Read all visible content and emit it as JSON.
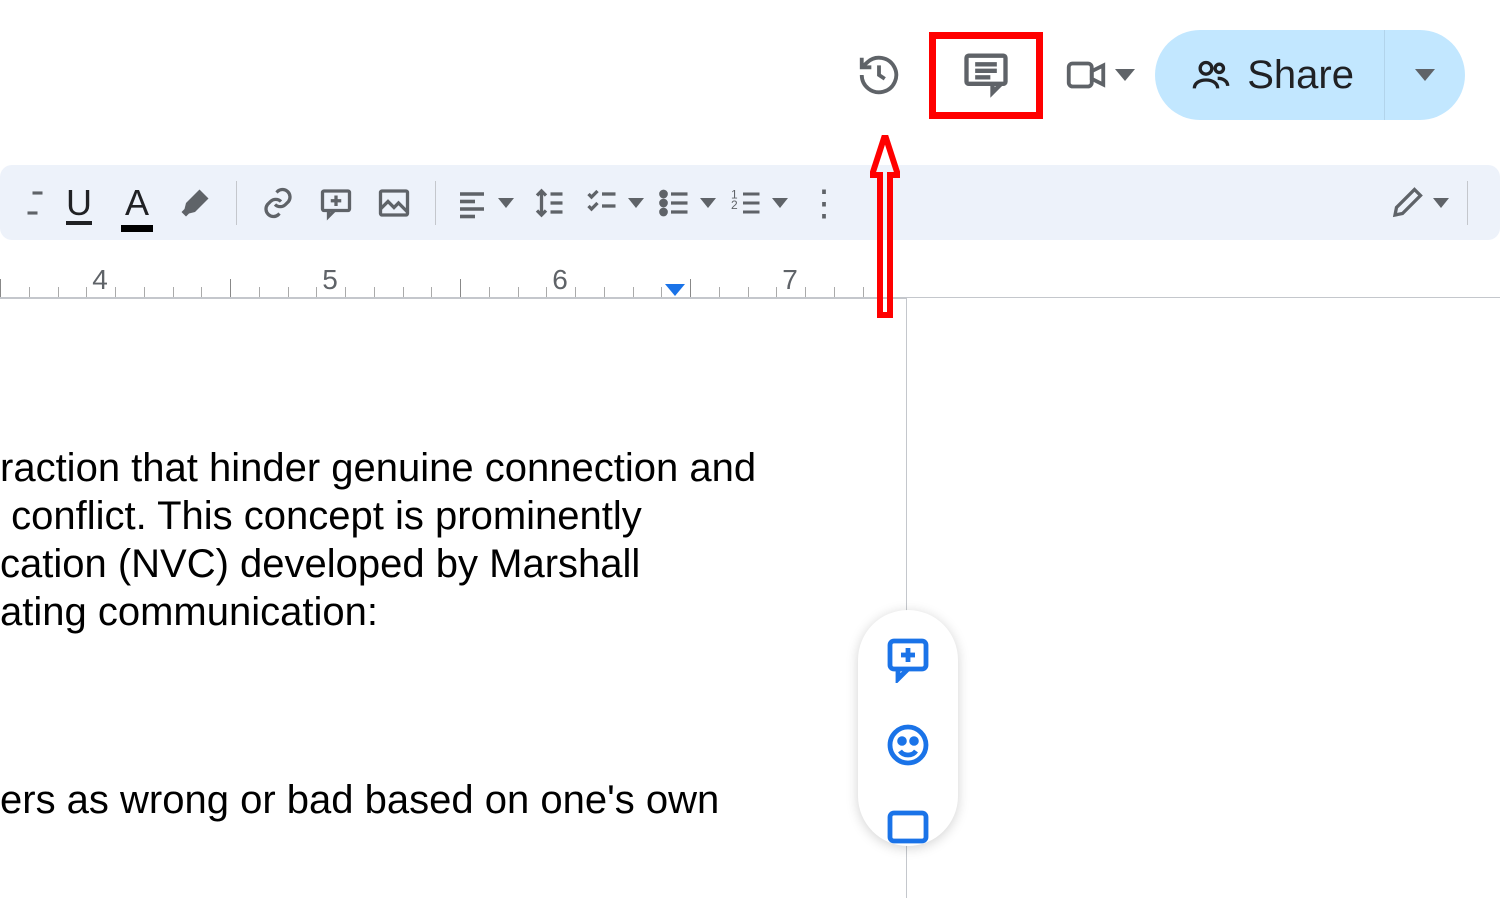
{
  "top_actions": {
    "share_label": "Share"
  },
  "toolbar": {
    "icons": {
      "underline": "U",
      "text_color": "A"
    }
  },
  "ruler": {
    "labels": [
      "4",
      "5",
      "6",
      "7"
    ]
  },
  "document": {
    "paragraph1_line1": "raction that hinder genuine connection and",
    "paragraph1_line2": " conflict. This concept is prominently",
    "paragraph1_line3": "cation (NVC) developed by Marshall",
    "paragraph1_line4": "ating communication:",
    "paragraph2_line1": "ers as wrong or bad based on one's own"
  },
  "annotations": {
    "highlighted_element": "comment-history-button",
    "highlight_style": "red-box-with-arrow"
  }
}
